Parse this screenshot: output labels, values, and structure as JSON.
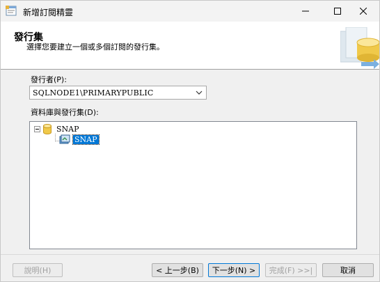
{
  "window": {
    "title": "新增訂閱精靈",
    "icons": [
      "app-icon",
      "minimize-icon",
      "maximize-icon",
      "close-icon"
    ]
  },
  "banner": {
    "heading": "發行集",
    "subtitle": "選擇您要建立一個或多個訂閱的發行集。"
  },
  "publisher": {
    "label": "發行者(P):",
    "value": "SQLNODE1\\PRIMARYPUBLIC"
  },
  "tree": {
    "label": "資料庫與發行集(D):",
    "root": {
      "label": "SNAP",
      "icon": "database-icon",
      "expanded": true
    },
    "child": {
      "label": "SNAP",
      "icon": "publication-icon",
      "selected": true
    }
  },
  "buttons": {
    "help": "說明(H)",
    "back": "< 上一步(B)",
    "next": "下一步(N) >",
    "finish": "完成(F) >>|",
    "cancel": "取消"
  },
  "colors": {
    "selection": "#0078d7",
    "banner_bg": "#ffffff",
    "window_bg": "#f0f0f0"
  }
}
